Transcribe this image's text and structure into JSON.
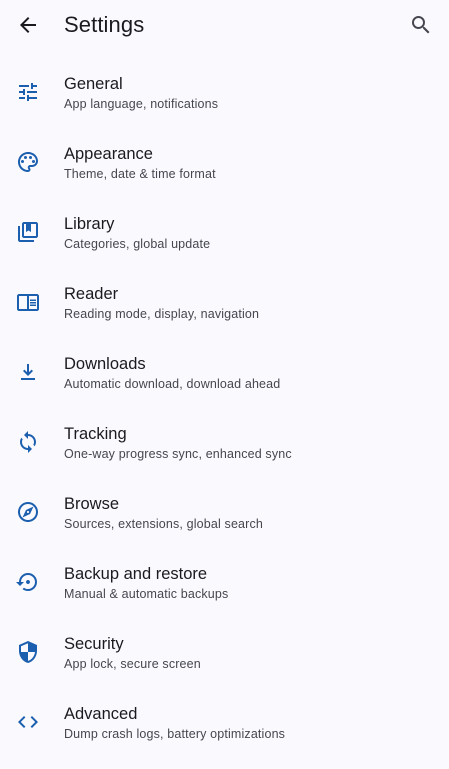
{
  "header": {
    "title": "Settings",
    "back_icon": "arrow-back-icon",
    "search_icon": "search-icon"
  },
  "colors": {
    "accent": "#1c5fae",
    "background": "#fafafe",
    "text_primary": "#1b1b1f",
    "text_secondary": "#45464f"
  },
  "items": [
    {
      "title": "General",
      "subtitle": "App language, notifications",
      "icon": "tune-icon"
    },
    {
      "title": "Appearance",
      "subtitle": "Theme, date & time format",
      "icon": "palette-icon"
    },
    {
      "title": "Library",
      "subtitle": "Categories, global update",
      "icon": "library-icon"
    },
    {
      "title": "Reader",
      "subtitle": "Reading mode, display, navigation",
      "icon": "reader-icon"
    },
    {
      "title": "Downloads",
      "subtitle": "Automatic download, download ahead",
      "icon": "download-icon"
    },
    {
      "title": "Tracking",
      "subtitle": "One-way progress sync, enhanced sync",
      "icon": "sync-icon"
    },
    {
      "title": "Browse",
      "subtitle": "Sources, extensions, global search",
      "icon": "compass-icon"
    },
    {
      "title": "Backup and restore",
      "subtitle": "Manual & automatic backups",
      "icon": "backup-restore-icon"
    },
    {
      "title": "Security",
      "subtitle": "App lock, secure screen",
      "icon": "shield-icon"
    },
    {
      "title": "Advanced",
      "subtitle": "Dump crash logs, battery optimizations",
      "icon": "code-icon"
    }
  ]
}
